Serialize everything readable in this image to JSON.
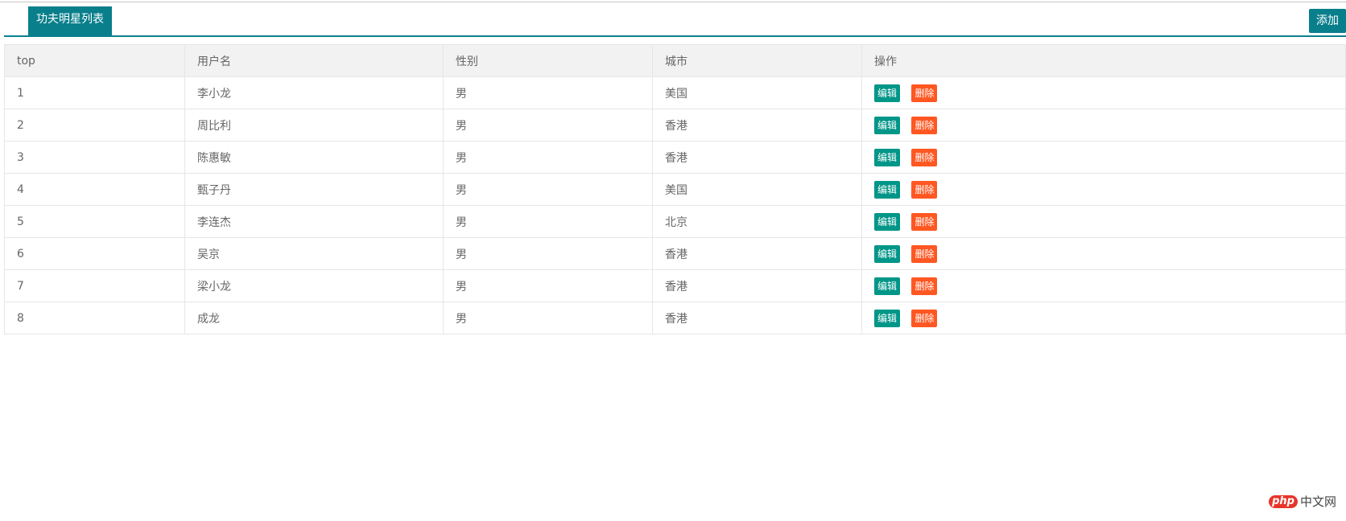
{
  "header": {
    "tab_title": "功夫明星列表",
    "add_label": "添加"
  },
  "table": {
    "columns": [
      "top",
      "用户名",
      "性别",
      "城市",
      "操作"
    ],
    "rows": [
      {
        "top": "1",
        "name": "李小龙",
        "gender": "男",
        "city": "美国"
      },
      {
        "top": "2",
        "name": "周比利",
        "gender": "男",
        "city": "香港"
      },
      {
        "top": "3",
        "name": "陈惠敏",
        "gender": "男",
        "city": "香港"
      },
      {
        "top": "4",
        "name": "甄子丹",
        "gender": "男",
        "city": "美国"
      },
      {
        "top": "5",
        "name": "李连杰",
        "gender": "男",
        "city": "北京"
      },
      {
        "top": "6",
        "name": "吴京",
        "gender": "男",
        "city": "香港"
      },
      {
        "top": "7",
        "name": "梁小龙",
        "gender": "男",
        "city": "香港"
      },
      {
        "top": "8",
        "name": "成龙",
        "gender": "男",
        "city": "香港"
      }
    ],
    "actions": {
      "edit_label": "编辑",
      "delete_label": "删除"
    }
  },
  "watermark": {
    "logo": "php",
    "text": "中文网"
  },
  "colors": {
    "accent": "#0a7f8c",
    "edit": "#009688",
    "delete": "#ff5722",
    "header_bg": "#f2f2f2"
  }
}
